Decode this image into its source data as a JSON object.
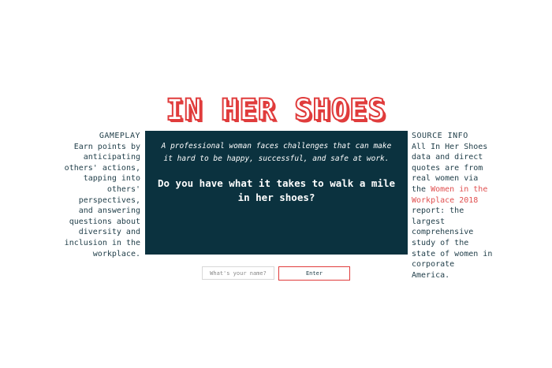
{
  "title": "IN HER SHOES",
  "gameplay": {
    "heading": "GAMEPLAY",
    "body": "Earn points by anticipating others' actions, tapping into others' perspectives, and answering questions about diversity and inclusion in the workplace."
  },
  "source": {
    "heading": "SOURCE INFO",
    "text_before": "All In Her Shoes data and direct quotes are from real women via the",
    "link_text": "Women in the Workplace 2018",
    "text_after": "report: the largest comprehensive study of the state of women in corporate America."
  },
  "panel": {
    "tagline": "A professional woman faces challenges that can make it hard to be happy, successful, and safe at work.",
    "question": "Do you have what it takes to walk a mile in her shoes?"
  },
  "form": {
    "name_placeholder": "What's your name?",
    "name_value": "",
    "enter_label": "Enter"
  },
  "colors": {
    "accent": "#e03c3c",
    "panel_bg": "#0b323f",
    "text": "#1f3d48"
  }
}
